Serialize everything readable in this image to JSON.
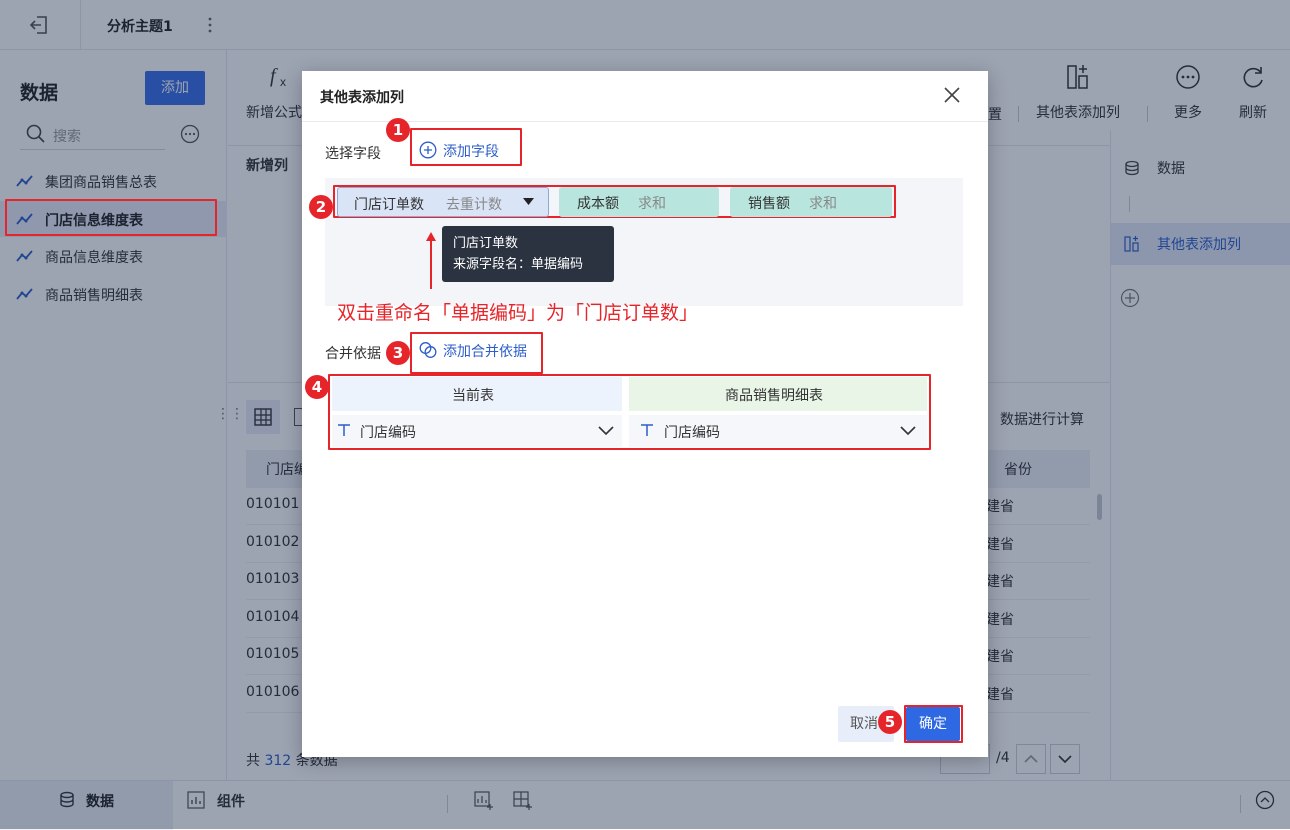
{
  "topbar": {
    "title": "分析主题1"
  },
  "left": {
    "title": "数据",
    "add_label": "添加",
    "search_placeholder": "搜索",
    "tables": [
      {
        "label": "集团商品销售总表",
        "active": false
      },
      {
        "label": "门店信息维度表",
        "active": true
      },
      {
        "label": "商品信息维度表",
        "active": false
      },
      {
        "label": "商品销售明细表",
        "active": false
      }
    ]
  },
  "toolbar": {
    "items": [
      {
        "label": "新增公式列",
        "icon": "fx-icon"
      },
      {
        "label": "其他表添加列",
        "icon": "add-column-icon"
      },
      {
        "label": "更多",
        "icon": "more-icon"
      },
      {
        "label": "刷新",
        "icon": "refresh-icon"
      }
    ],
    "partial_label": "置"
  },
  "center": {
    "step_label": "新增列",
    "compute_label": "数据进行计算",
    "col_header_1": "门店编",
    "col_header_2": "省份",
    "rows": [
      {
        "c1": "010101",
        "c2": "建省"
      },
      {
        "c1": "010102",
        "c2": "建省"
      },
      {
        "c1": "010103",
        "c2": "建省"
      },
      {
        "c1": "010104",
        "c2": "建省"
      },
      {
        "c1": "010105",
        "c2": "建省"
      },
      {
        "c1": "010106",
        "c2": "建省"
      }
    ],
    "footer_prefix": "共",
    "footer_count": "312",
    "footer_suffix": "条数据",
    "page_total": "/4"
  },
  "rightpanel": {
    "items": [
      {
        "label": "数据",
        "icon": "database-icon"
      },
      {
        "label": "其他表添加列",
        "icon": "add-column-icon"
      }
    ]
  },
  "bottombar": {
    "data_tab": "数据",
    "component_tab": "组件"
  },
  "modal": {
    "title": "其他表添加列",
    "select_field_label": "选择字段",
    "add_field_label": "添加字段",
    "chips": [
      {
        "name": "门店订单数",
        "agg": "去重计数",
        "color": "#d9e4f7"
      },
      {
        "name": "成本额",
        "agg": "求和",
        "color": "#b8e5dd"
      },
      {
        "name": "销售额",
        "agg": "求和",
        "color": "#b8e5dd"
      }
    ],
    "tooltip_line1": "门店订单数",
    "tooltip_line2": "来源字段名：单据编码",
    "annotation": "双击重命名「单据编码」为「门店订单数」",
    "merge_label": "合并依据",
    "add_merge_label": "添加合并依据",
    "merge_header_left": "当前表",
    "merge_header_right": "商品销售明细表",
    "merge_left_field": "门店编码",
    "merge_right_field": "门店编码",
    "cancel_label": "取消",
    "ok_label": "确定"
  },
  "badges": [
    "1",
    "2",
    "3",
    "4",
    "5"
  ]
}
